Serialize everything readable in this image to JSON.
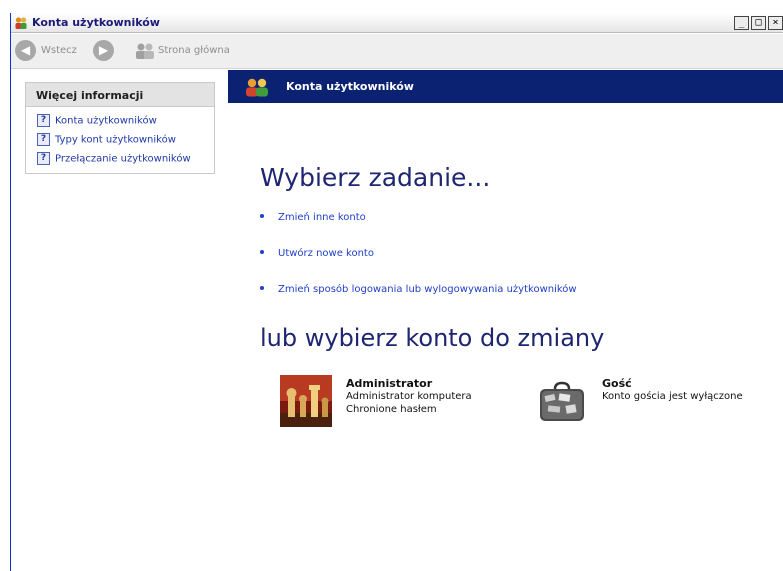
{
  "window": {
    "title": "Konta użytkowników",
    "minimize_label": "_",
    "maximize_label": "□",
    "close_label": "×"
  },
  "toolbar": {
    "back_label": "Wstecz",
    "home_label": "Strona główna"
  },
  "sidebar": {
    "panel_title": "Więcej informacji",
    "links": [
      "Konta użytkowników",
      "Typy kont użytkowników",
      "Przełączanie użytkowników"
    ]
  },
  "main": {
    "banner_title": "Konta użytkowników",
    "pick_task_heading": "Wybierz zadanie...",
    "tasks": [
      "Zmień inne konto",
      "Utwórz nowe konto",
      "Zmień sposób logowania lub wylogowywania użytkowników"
    ],
    "pick_account_heading": "lub wybierz konto do zmiany",
    "accounts": [
      {
        "name": "Administrator",
        "line1": "Administrator komputera",
        "line2": "Chronione hasłem"
      },
      {
        "name": "Gość",
        "line1": "Konto gościa jest wyłączone"
      }
    ]
  },
  "colors": {
    "banner": "#0b2273",
    "link": "#2140c8",
    "heading": "#1e2672"
  }
}
